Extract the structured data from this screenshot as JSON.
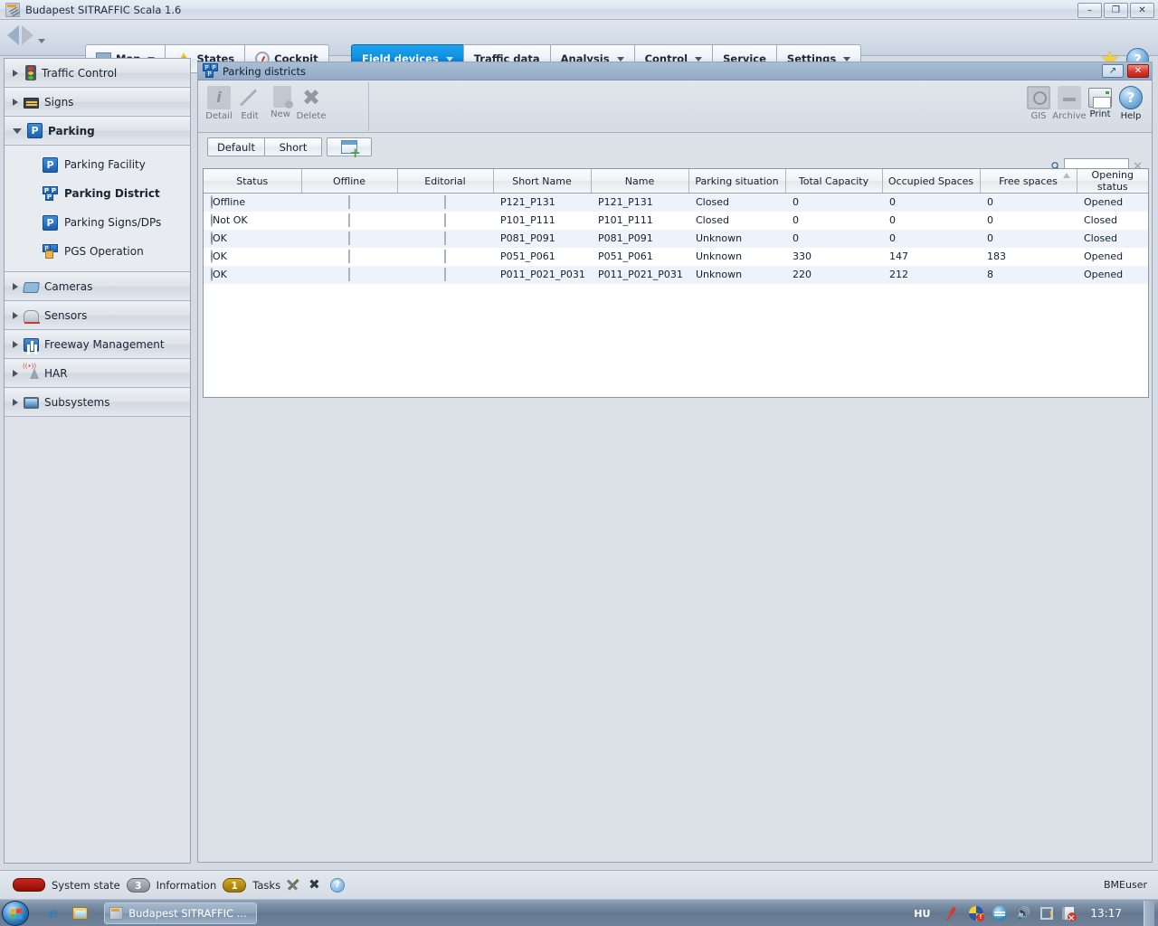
{
  "window": {
    "title": "Budapest SITRAFFIC Scala 1.6",
    "app_icon": "app-icon",
    "minimize": "–",
    "restore": "❐",
    "close": "✕"
  },
  "toolbar": {
    "back_icon": "back-arrow-icon",
    "forward_icon": "forward-arrow-icon",
    "history_caret_icon": "chevron-down-icon",
    "buttons": [
      {
        "label": "Map",
        "icon": "map-icon",
        "has_caret": true,
        "selected": false
      },
      {
        "label": "States",
        "icon": "warning-triangle-icon",
        "has_caret": false,
        "selected": false
      },
      {
        "label": "Cockpit",
        "icon": "gauge-icon",
        "has_caret": false,
        "selected": false
      }
    ],
    "menus": [
      {
        "label": "Field devices",
        "has_caret": true,
        "selected": true
      },
      {
        "label": "Traffic data",
        "has_caret": false,
        "selected": false
      },
      {
        "label": "Analysis",
        "has_caret": true,
        "selected": false
      },
      {
        "label": "Control",
        "has_caret": true,
        "selected": false
      },
      {
        "label": "Service",
        "has_caret": false,
        "selected": false
      },
      {
        "label": "Settings",
        "has_caret": true,
        "selected": false
      }
    ],
    "favorites_icon": "star-icon",
    "help_icon": "help-icon"
  },
  "sidebar": {
    "items": [
      {
        "label": "Traffic Control",
        "icon": "traffic-light-icon",
        "expanded": false
      },
      {
        "label": "Signs",
        "icon": "variable-sign-icon",
        "expanded": false
      },
      {
        "label": "Parking",
        "icon": "parking-icon",
        "expanded": true
      },
      {
        "label": "Cameras",
        "icon": "camera-icon",
        "expanded": false
      },
      {
        "label": "Sensors",
        "icon": "weather-sensor-icon",
        "expanded": false
      },
      {
        "label": "Freeway Management",
        "icon": "freeway-icon",
        "expanded": false
      },
      {
        "label": "HAR",
        "icon": "radio-tower-icon",
        "expanded": false
      },
      {
        "label": "Subsystems",
        "icon": "monitor-icon",
        "expanded": false
      }
    ],
    "parking_children": [
      {
        "label": "Parking Facility",
        "icon": "parking-facility-icon",
        "active": false
      },
      {
        "label": "Parking District",
        "icon": "parking-district-icon",
        "active": true
      },
      {
        "label": "Parking Signs/DPs",
        "icon": "parking-sign-icon",
        "active": false
      },
      {
        "label": "PGS Operation",
        "icon": "pgs-operation-icon",
        "active": false
      }
    ]
  },
  "panel": {
    "title": "Parking districts",
    "title_icon": "parking-district-icon",
    "restore_label": "↗",
    "close_label": "✕",
    "ribbon_left": [
      {
        "label": "Detail",
        "icon": "detail-icon",
        "enabled": false
      },
      {
        "label": "Edit",
        "icon": "edit-pencil-icon",
        "enabled": false
      },
      {
        "label": "New",
        "icon": "new-document-icon",
        "enabled": false
      },
      {
        "label": "Delete",
        "icon": "delete-x-icon",
        "enabled": false
      }
    ],
    "ribbon_right": [
      {
        "label": "GIS",
        "icon": "gis-icon",
        "enabled": false
      },
      {
        "label": "Archive",
        "icon": "archive-icon",
        "enabled": false
      },
      {
        "label": "Print",
        "icon": "printer-icon",
        "enabled": true
      },
      {
        "label": "Help",
        "icon": "help-icon",
        "enabled": true
      }
    ],
    "views": [
      {
        "label": "Default",
        "selected": true
      },
      {
        "label": "Short",
        "selected": false
      }
    ],
    "add_column_icon": "add-column-icon",
    "search": {
      "icon": "search-key-icon",
      "value": "",
      "placeholder": "",
      "clear_icon": "clear-x-icon"
    }
  },
  "table": {
    "columns": [
      {
        "label": "Status",
        "sorted": false
      },
      {
        "label": "Offline",
        "sorted": false
      },
      {
        "label": "Editorial",
        "sorted": false
      },
      {
        "label": "Short Name",
        "sorted": false
      },
      {
        "label": "Name",
        "sorted": false
      },
      {
        "label": "Parking situation",
        "sorted": false
      },
      {
        "label": "Total Capacity",
        "sorted": false
      },
      {
        "label": "Occupied Spaces",
        "sorted": false
      },
      {
        "label": "Free spaces",
        "sorted": true,
        "sort_dir": "asc"
      },
      {
        "label": "Opening status",
        "sorted": false
      }
    ],
    "rows": [
      {
        "status_led": "yellow",
        "status": "Offline",
        "offline": false,
        "editorial": false,
        "short_name": "P121_P131",
        "name": "P121_P131",
        "parking_situation": "Closed",
        "total_capacity": "0",
        "occupied_spaces": "0",
        "free_spaces": "0",
        "opening_status": "Opened"
      },
      {
        "status_led": "red",
        "status": "Not OK",
        "offline": false,
        "editorial": false,
        "short_name": "P101_P111",
        "name": "P101_P111",
        "parking_situation": "Closed",
        "total_capacity": "0",
        "occupied_spaces": "0",
        "free_spaces": "0",
        "opening_status": "Closed"
      },
      {
        "status_led": "green",
        "status": "OK",
        "offline": false,
        "editorial": false,
        "short_name": "P081_P091",
        "name": "P081_P091",
        "parking_situation": "Unknown",
        "total_capacity": "0",
        "occupied_spaces": "0",
        "free_spaces": "0",
        "opening_status": "Closed"
      },
      {
        "status_led": "green",
        "status": "OK",
        "offline": false,
        "editorial": false,
        "short_name": "P051_P061",
        "name": "P051_P061",
        "parking_situation": "Unknown",
        "total_capacity": "330",
        "occupied_spaces": "147",
        "free_spaces": "183",
        "opening_status": "Opened"
      },
      {
        "status_led": "green",
        "status": "OK",
        "offline": false,
        "editorial": false,
        "short_name": "P011_P021_P031",
        "name": "P011_P021_P031",
        "parking_situation": "Unknown",
        "total_capacity": "220",
        "occupied_spaces": "212",
        "free_spaces": "8",
        "opening_status": "Opened"
      }
    ]
  },
  "statusbar": {
    "system_state_label": "System state",
    "system_state_color": "#b4201a",
    "information_count": "3",
    "information_label": "Information",
    "tasks_count": "1",
    "tasks_label": "Tasks",
    "tools_icon": "tools-icon",
    "mute_icon": "sound-muted-icon",
    "help_icon": "help-icon",
    "user": "BMEuser"
  },
  "taskbar": {
    "start_icon": "windows-start-icon",
    "quick_launch": [
      {
        "icon": "internet-explorer-icon",
        "label": "e"
      },
      {
        "icon": "file-explorer-icon",
        "label": ""
      }
    ],
    "task_items": [
      {
        "label": "Budapest SITRAFFIC ...",
        "icon": "app-icon",
        "active": true
      }
    ],
    "tray": {
      "language": "HU",
      "icons": [
        "pin-icon",
        "network-warning-icon",
        "blue-circle-icon",
        "volume-icon",
        "action-center-warning-icon",
        "flag-error-icon"
      ],
      "clock": "13:17",
      "show_desktop_icon": "show-desktop-icon"
    }
  }
}
